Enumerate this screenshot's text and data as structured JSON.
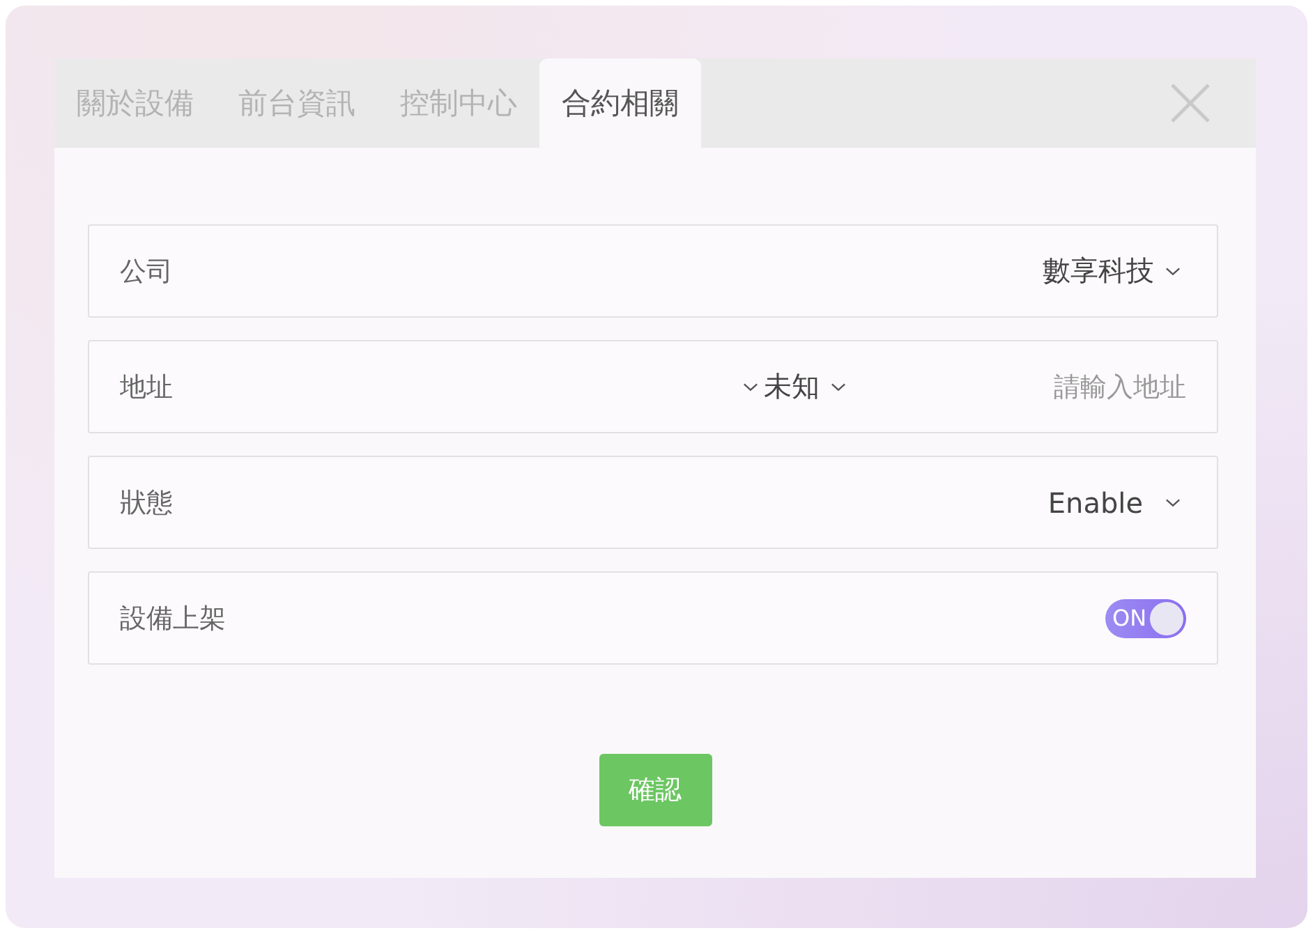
{
  "tabs": [
    {
      "label": "關於設備",
      "selected": false
    },
    {
      "label": "前台資訊",
      "selected": false
    },
    {
      "label": "控制中心",
      "selected": false
    },
    {
      "label": "合約相關",
      "selected": true
    }
  ],
  "fields": [
    {
      "kind": "select",
      "label": "公司",
      "value": "數享科技"
    },
    {
      "kind": "address",
      "label": "地址",
      "region": "未知",
      "placeholder": "請輸入地址"
    },
    {
      "kind": "select",
      "label": "狀態",
      "value": "Enable"
    },
    {
      "kind": "toggle",
      "label": "設備上架",
      "on": true,
      "on_text": "ON"
    }
  ],
  "confirm_button": {
    "label": "確認"
  }
}
